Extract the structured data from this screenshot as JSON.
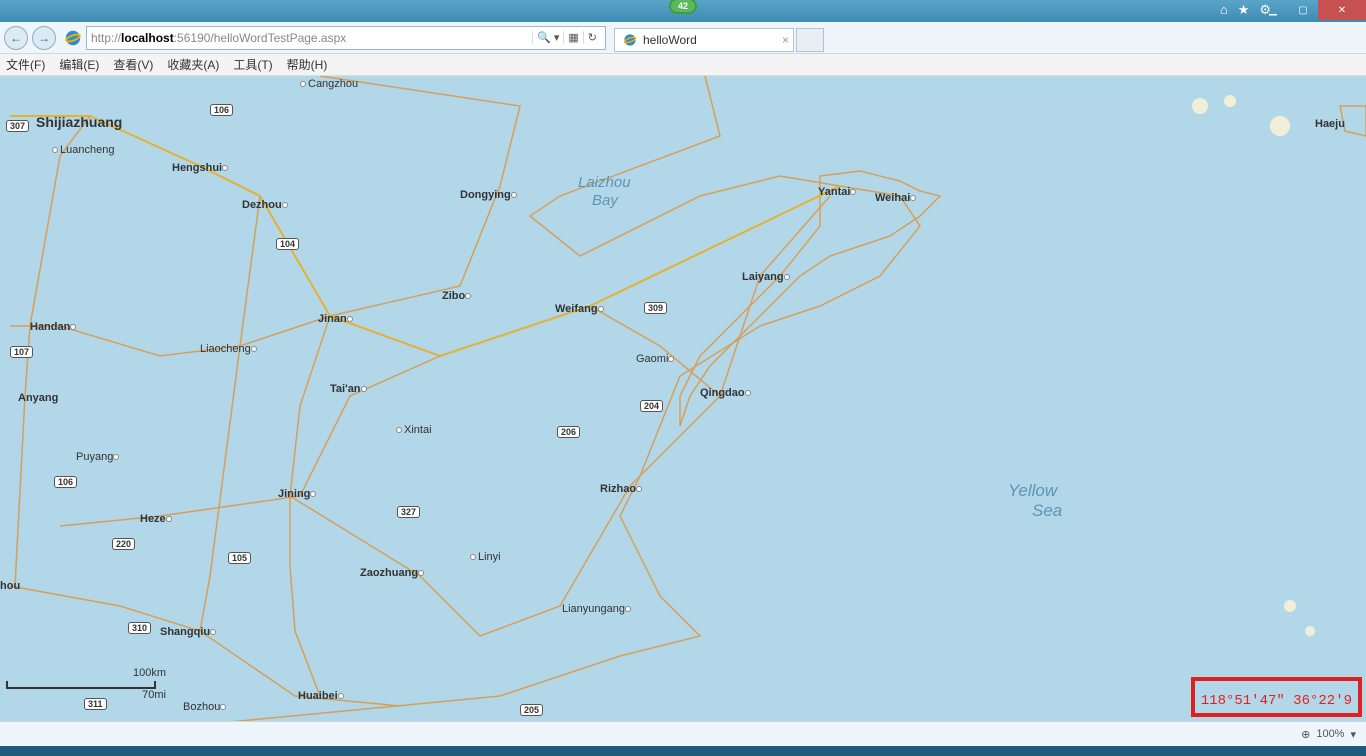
{
  "titlebar": {
    "badge": "42"
  },
  "nav": {
    "url_prefix": "http://",
    "url_host": "localhost",
    "url_rest": ":56190/helloWordTestPage.aspx",
    "tab_title": "helloWord"
  },
  "menu": {
    "file": "文件(F)",
    "edit": "编辑(E)",
    "view": "查看(V)",
    "fav": "收藏夹(A)",
    "tools": "工具(T)",
    "help": "帮助(H)"
  },
  "map": {
    "sea_labels": {
      "laizhou1": "Laizhou",
      "laizhou2": "Bay",
      "yellow1": "Yellow",
      "yellow2": "Sea"
    },
    "cities": {
      "shijiazhuang": "Shijiazhuang",
      "luancheng": "Luancheng",
      "hengshui": "Hengshui",
      "dezhou": "Dezhou",
      "cangzhou": "Cangzhou",
      "dongying": "Dongying",
      "yantai": "Yantai",
      "weihai": "Weihai",
      "haeju": "Haeju",
      "laiyang": "Laiyang",
      "handan": "Handan",
      "liaocheng": "Liaocheng",
      "jinan": "Jinan",
      "zibo": "Zibo",
      "weifang": "Weifang",
      "gaomi": "Gaomi",
      "qingdao": "Qingdao",
      "taian": "Tai'an",
      "anyang": "Anyang",
      "xintai": "Xintai",
      "puyang": "Puyang",
      "jining": "Jining",
      "rizhao": "Rizhao",
      "heze": "Heze",
      "linyi": "Linyi",
      "zaozhuang": "Zaozhuang",
      "lianyungang": "Lianyungang",
      "shangqiu": "Shangqiu",
      "huaibei": "Huaibei",
      "bozhou": "Bozhou",
      "hou": "hou"
    },
    "shields": {
      "s307": "307",
      "s106": "106",
      "s104": "104",
      "s309": "309",
      "s107": "107",
      "s204": "204",
      "s206": "206",
      "s106b": "106",
      "s327": "327",
      "s220": "220",
      "s105": "105",
      "s310": "310",
      "s311": "311",
      "s205": "205"
    },
    "scale": {
      "km": "100km",
      "mi": "70mi"
    },
    "coords": "118°51'47\" 36°22'9"
  },
  "status": {
    "zoom": "100%"
  }
}
